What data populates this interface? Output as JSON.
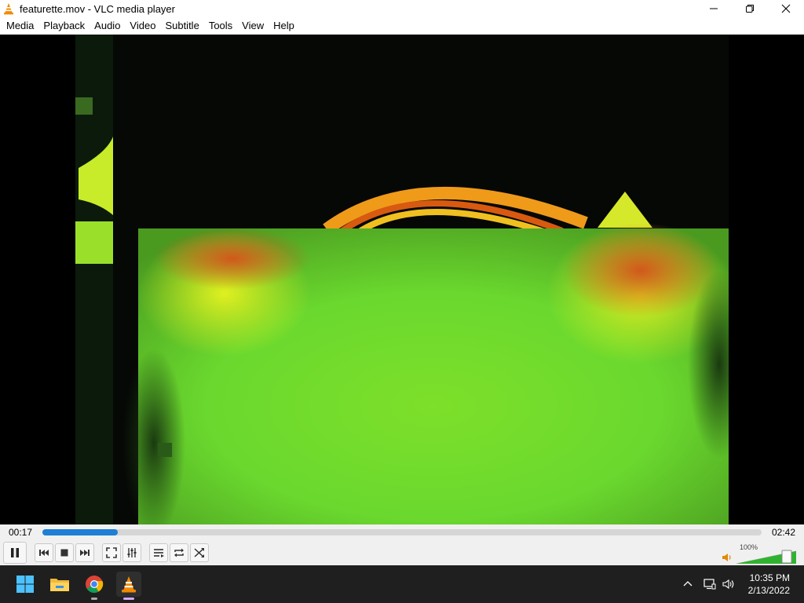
{
  "window": {
    "title": "featurette.mov - VLC media player"
  },
  "menu": {
    "items": [
      "Media",
      "Playback",
      "Audio",
      "Video",
      "Subtitle",
      "Tools",
      "View",
      "Help"
    ]
  },
  "playback": {
    "elapsed": "00:17",
    "duration": "02:42",
    "progress_fraction": 0.105
  },
  "volume": {
    "label": "100%",
    "level_fraction": 1.0
  },
  "colors": {
    "seek_fill": "#1d7fd6",
    "volume_fill": "#2fb32f",
    "taskbar": "#1f1f1f"
  },
  "taskbar": {
    "apps": [
      {
        "name": "windows-start-icon"
      },
      {
        "name": "file-explorer-icon"
      },
      {
        "name": "chrome-icon"
      },
      {
        "name": "vlc-icon"
      }
    ],
    "time": "10:35 PM",
    "date": "2/13/2022"
  }
}
